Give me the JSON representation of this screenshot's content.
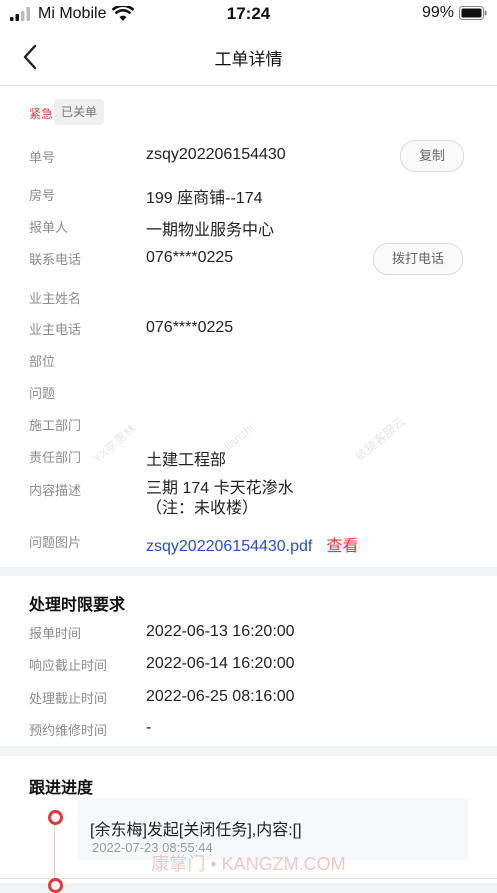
{
  "status_bar": {
    "carrier": "Mi Mobile",
    "time": "17:24",
    "battery": "99%"
  },
  "nav": {
    "title": "工单详情"
  },
  "tags": {
    "urgent": "紧急",
    "status": "已关单"
  },
  "details": {
    "order_no": {
      "label": "单号",
      "value": "zsqy202206154430",
      "button": "复制"
    },
    "room": {
      "label": "房号",
      "value": "199 座商铺--174"
    },
    "reporter": {
      "label": "报单人",
      "value": "一期物业服务中心"
    },
    "contact_phone": {
      "label": "联系电话",
      "value": "076****0225",
      "button": "拨打电话"
    },
    "owner_name": {
      "label": "业主姓名",
      "value": ""
    },
    "owner_phone": {
      "label": "业主电话",
      "value": "076****0225"
    },
    "part": {
      "label": "部位",
      "value": ""
    },
    "issue": {
      "label": "问题",
      "value": ""
    },
    "construction_dept": {
      "label": "施工部门",
      "value": ""
    },
    "responsible_dept": {
      "label": "责任部门",
      "value": "土建工程部"
    },
    "description": {
      "label": "内容描述",
      "line1": "三期 174 卡天花渗水",
      "line2": "（注：未收楼）"
    },
    "issue_image": {
      "label": "问题图片",
      "file": "zsqy202206154430.pdf",
      "view": "查看"
    }
  },
  "time_requirements": {
    "title": "处理时限要求",
    "report_time": {
      "label": "报单时间",
      "value": "2022-06-13 16:20:00"
    },
    "response_deadline": {
      "label": "响应截止时间",
      "value": "2022-06-14 16:20:00"
    },
    "process_deadline": {
      "label": "处理截止时间",
      "value": "2022-06-25 08:16:00"
    },
    "appointment_time": {
      "label": "预约维修时间",
      "value": "-"
    }
  },
  "progress": {
    "title": "跟进进度",
    "entries": [
      {
        "text": "[余东梅]发起[关闭任务],内容:[]",
        "time": "2022-07-23 08:55:44"
      }
    ]
  },
  "watermarks": {
    "a": "YX李惠林",
    "b": "lianzhi",
    "c": "敏捷客服云",
    "bottom": "康掌门 • KANGZM.COM"
  },
  "colors": {
    "accent_red": "#e0393b",
    "link_blue": "#2a4cc8"
  }
}
